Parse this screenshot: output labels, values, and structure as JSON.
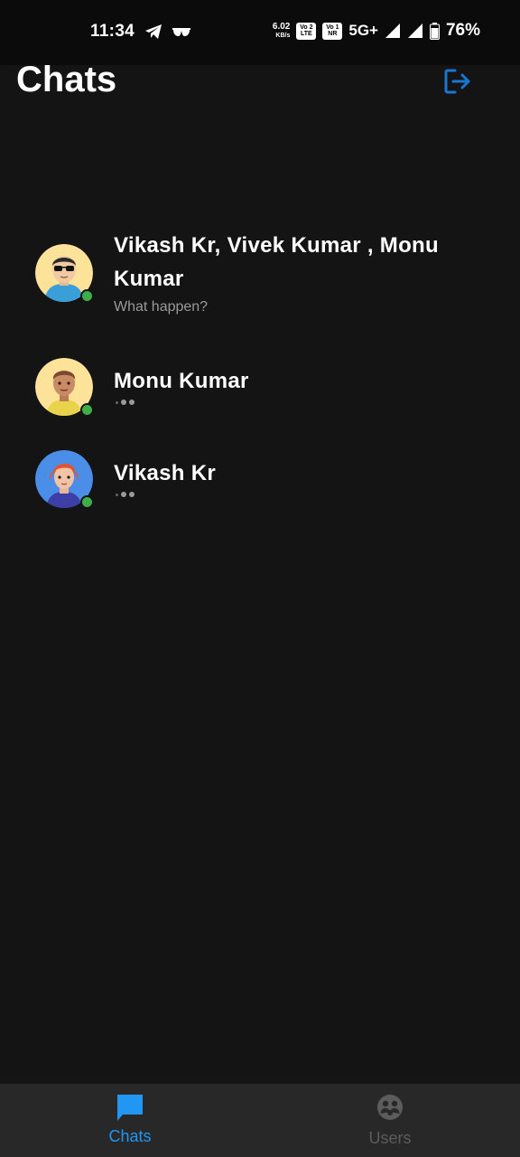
{
  "status_bar": {
    "time": "11:34",
    "net_speed_value": "6.02",
    "net_speed_unit": "KB/s",
    "sim1_badge": [
      "Vo",
      "LTE"
    ],
    "sim1_badge_num": "2",
    "sim2_badge": [
      "Vo",
      "NR"
    ],
    "sim2_badge_num": "1",
    "network_type": "5G+",
    "battery_percent": "76%"
  },
  "header": {
    "title": "Chats",
    "logout_icon": "logout-icon"
  },
  "chats": [
    {
      "name": "Vikash Kr, Vivek Kumar , Monu Kumar",
      "last_message": "What happen?",
      "online": true,
      "avatar": "sunglasses-man-avatar"
    },
    {
      "name": "Monu Kumar",
      "last_message": "",
      "typing_indicator": true,
      "online": true,
      "avatar": "brown-hair-man-avatar"
    },
    {
      "name": "Vikash Kr",
      "last_message": "",
      "typing_indicator": true,
      "online": true,
      "avatar": "red-hair-woman-avatar"
    }
  ],
  "bottom_nav": {
    "items": [
      {
        "label": "Chats",
        "icon": "chat-bubble-icon",
        "active": true
      },
      {
        "label": "Users",
        "icon": "users-icon",
        "active": false
      }
    ]
  },
  "colors": {
    "background": "#141414",
    "accent": "#2196f3",
    "logout_icon": "#1976d2",
    "online": "#3fae49",
    "nav_background": "#282828",
    "inactive_nav": "#5c5c5c"
  }
}
